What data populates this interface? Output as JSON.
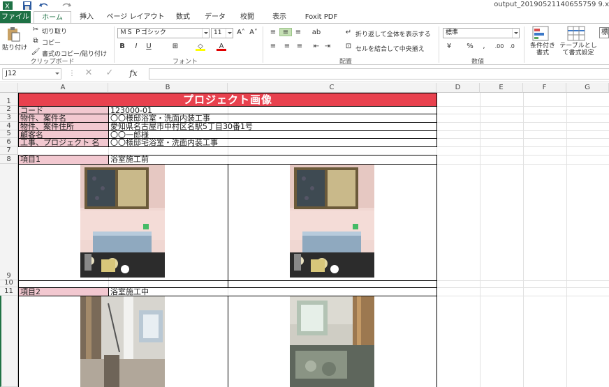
{
  "window": {
    "title": "output_20190521140655759 9.x"
  },
  "tabs": [
    "ファイル",
    "ホーム",
    "挿入",
    "ページ レイアウト",
    "数式",
    "データ",
    "校閲",
    "表示",
    "Foxit PDF"
  ],
  "ribbon": {
    "clipboard": {
      "paste": "貼り付け",
      "cut": "切り取り",
      "copy": "コピー",
      "format_painter": "書式のコピー/貼り付け",
      "label": "クリップボード"
    },
    "font": {
      "name": "ＭＳ Ｐゴシック",
      "size": "11",
      "bold": "B",
      "italic": "I",
      "underline": "U",
      "label": "フォント"
    },
    "alignment": {
      "wrap_text": "折り返して全体を表示する",
      "merge_center": "セルを結合して中央揃え",
      "label": "配置"
    },
    "number": {
      "format": "標準",
      "percent": "%",
      "label": "数値"
    },
    "styles": {
      "conditional": "条件付き書式",
      "table": "テーブルとして書式設定",
      "partial": "標"
    }
  },
  "formula_bar": {
    "name_box": "J12",
    "fx": "fx",
    "value": ""
  },
  "columns": [
    "A",
    "B",
    "C",
    "D",
    "E",
    "F",
    "G"
  ],
  "rows": [
    "1",
    "2",
    "3",
    "4",
    "5",
    "6",
    "7",
    "8",
    "9",
    "10",
    "11"
  ],
  "sheet": {
    "title": "プロジェクト画像",
    "labels": [
      "コード",
      "物件、案件名",
      "物件、案件住所",
      "顧客名",
      "工事、プロジェクト 名"
    ],
    "values": [
      "123000-01",
      "〇〇様邸浴室・洗面内装工事",
      "愛知県名古屋市中村区名駅5丁目30番1号",
      "〇〇一郎様",
      "〇〇様邸宅浴室・洗面内装工事"
    ],
    "item1_label": "項目1",
    "item1_value": "浴室施工前",
    "item2_label": "項目2",
    "item2_value": "浴室施工中"
  },
  "colors": {
    "excel_green": "#217346",
    "title_red": "#e8414e",
    "label_pink": "#f2c8d0"
  }
}
